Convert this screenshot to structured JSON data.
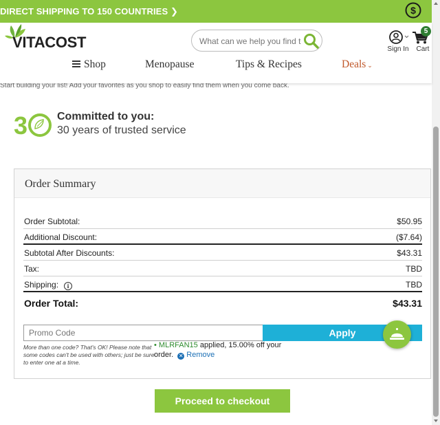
{
  "promo_bar": {
    "text": "DIRECT SHIPPING TO 150 COUNTRIES",
    "chevron": "❯",
    "icon": "dollar-circle-icon"
  },
  "header": {
    "logo_text": "VITACOST",
    "search": {
      "placeholder": "What can we help you find today?",
      "value": ""
    },
    "account_label": "Sign In",
    "cart_label": "Cart",
    "cart_count": "5"
  },
  "nav": {
    "shop": "Shop",
    "menopause": "Menopause",
    "tips": "Tips & Recipes",
    "deals": "Deals",
    "deals_color": "#c0582a"
  },
  "page": {
    "hint": "Start building your list! Add your favorites as you shop to easily find them when you come back.",
    "commit_badge": "30",
    "commit_title": "Committed to you:",
    "commit_subtitle": "30 years of trusted service"
  },
  "summary": {
    "title": "Order Summary",
    "rows": [
      {
        "label": "Order Subtotal:",
        "value": "$50.95"
      },
      {
        "label": "Additional Discount:",
        "value": "($7.64)"
      },
      {
        "label": "Subtotal After Discounts:",
        "value": "$43.31"
      },
      {
        "label": "Tax:",
        "value": "TBD"
      },
      {
        "label": "Shipping:",
        "value": "TBD"
      }
    ],
    "total_label": "Order Total:",
    "total_value": "$43.31",
    "promo_placeholder": "Promo Code",
    "apply_label": "Apply",
    "promo_note": "More than one code? That's OK! Please note that some codes can't be used with others; just be sure to enter one at a time.",
    "applied_code": "MLRFAN15",
    "applied_text": " applied, 15.00% off your order.",
    "remove_label": "Remove"
  },
  "checkout_label": "Proceed to checkout",
  "colors": {
    "brand_green": "#8cc63f",
    "apply_blue": "#1eb0d7",
    "link_blue": "#1b6fb5"
  }
}
